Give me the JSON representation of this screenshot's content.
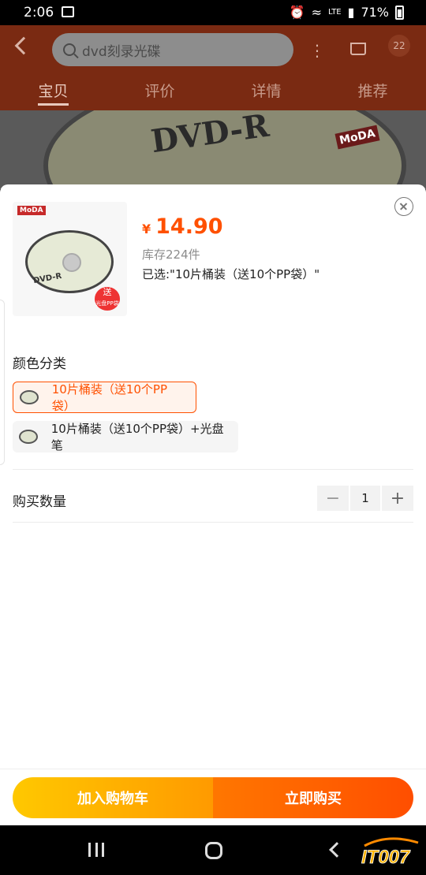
{
  "status_bar": {
    "time": "2:06",
    "network": "LTE",
    "battery": "71%"
  },
  "background": {
    "search_text": "dvd刻录光碟",
    "cart_badge": "22",
    "tabs": [
      "宝贝",
      "评价",
      "详情",
      "推荐"
    ],
    "active_tab": "宝贝"
  },
  "sheet": {
    "currency": "¥",
    "price": "14.90",
    "stock": "库存224件",
    "selected": "已选:\"10片桶装（送10个PP袋）\"",
    "color_section_title": "颜色分类",
    "options": [
      {
        "label": "10片桶装（送10个PP袋）",
        "selected": true
      },
      {
        "label": "10片桶装（送10个PP袋）+光盘笔",
        "selected": false
      }
    ],
    "quantity_label": "购买数量",
    "quantity": "1",
    "add_to_cart": "加入购物车",
    "buy_now": "立即购买"
  },
  "watermark": "IT007",
  "colors": {
    "accent": "#ff5000",
    "cart_gradient": [
      "#ffc800",
      "#ff9a00"
    ],
    "buy_gradient": [
      "#ff7700",
      "#ff4e00"
    ]
  }
}
